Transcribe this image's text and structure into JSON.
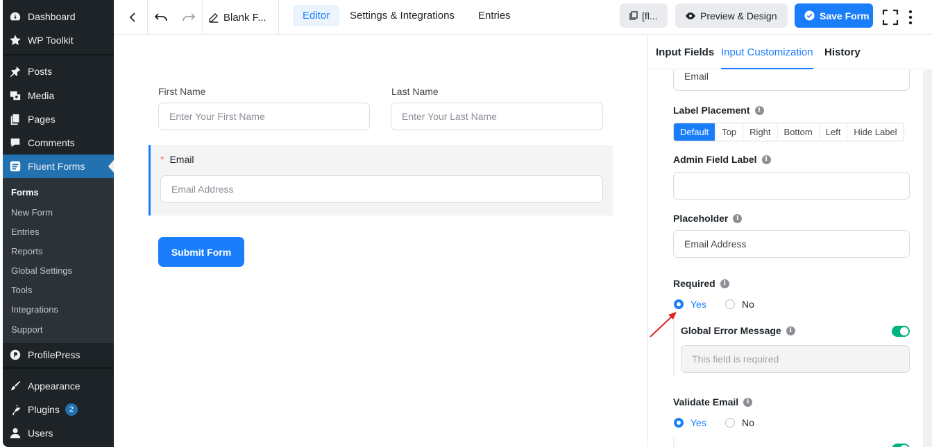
{
  "wp_menu": {
    "dashboard": "Dashboard",
    "wp_toolkit": "WP Toolkit",
    "posts": "Posts",
    "media": "Media",
    "pages": "Pages",
    "comments": "Comments",
    "fluent_forms": "Fluent Forms",
    "submenu": [
      "Forms",
      "New Form",
      "Entries",
      "Reports",
      "Global Settings",
      "Tools",
      "Integrations",
      "Support"
    ],
    "profilepress": "ProfilePress",
    "appearance": "Appearance",
    "plugins": "Plugins",
    "plugins_badge": "2",
    "users": "Users"
  },
  "topbar": {
    "form_title": "Blank F...",
    "tabs": [
      "Editor",
      "Settings & Integrations",
      "Entries"
    ],
    "shortcode": "[fl...",
    "preview": "Preview & Design",
    "save": "Save Form"
  },
  "form": {
    "first_name_label": "First Name",
    "first_name_placeholder": "Enter Your First Name",
    "last_name_label": "Last Name",
    "last_name_placeholder": "Enter Your Last Name",
    "required_star": "*",
    "email_label": "Email",
    "email_placeholder": "Email Address",
    "submit": "Submit Form"
  },
  "panel": {
    "tabs": [
      "Input Fields",
      "Input Customization",
      "History"
    ],
    "element_label_value": "Email",
    "label_placement": "Label Placement",
    "placement_options": [
      "Default",
      "Top",
      "Right",
      "Bottom",
      "Left",
      "Hide Label"
    ],
    "admin_field_label": "Admin Field Label",
    "admin_field_value": "",
    "placeholder_label": "Placeholder",
    "placeholder_value": "Email Address",
    "required_label": "Required",
    "yes": "Yes",
    "no": "No",
    "global_error_message": "Global Error Message",
    "error_placeholder": "This field is required",
    "validate_email": "Validate Email"
  },
  "colors": {
    "accent": "#1a7efb",
    "wp_sidebar": "#1d2327",
    "toggle_on": "#00b27f",
    "annotation_arrow": "#e02424"
  }
}
